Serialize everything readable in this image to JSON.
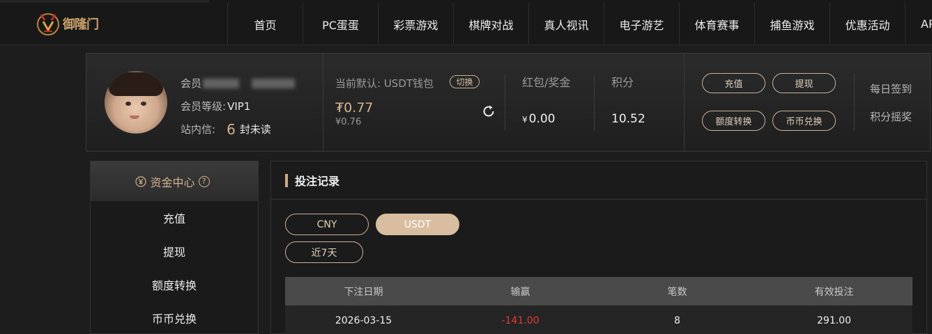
{
  "header": {
    "logo_text": "御隆门",
    "nav": [
      "首页",
      "PC蛋蛋",
      "彩票游戏",
      "棋牌对战",
      "真人视讯",
      "电子游艺",
      "体育赛事",
      "捕鱼游戏",
      "优惠活动",
      "AP"
    ]
  },
  "profile": {
    "member_label": "会员",
    "level_label": "会员等级:",
    "level_value": "VIP1",
    "mail_label": "站内信:",
    "unread_count": "6",
    "unread_text": "封未读",
    "wallet_label": "当前默认: USDT钱包",
    "switch_label": "切换",
    "usdt_balance": "₮0.77",
    "cny_balance": "¥0.76",
    "redpack_label": "红包/奖金",
    "redpack_currency": "¥",
    "redpack_value": "0.00",
    "points_label": "积分",
    "points_value": "10.52",
    "buttons": {
      "deposit": "充值",
      "withdraw": "提现",
      "transfer": "额度转换",
      "exchange": "币币兑换"
    },
    "daily_checkin": "每日签到",
    "points_lottery": "积分摇奖"
  },
  "sidebar": {
    "title": "资金中心",
    "help_glyph": "?",
    "items": [
      "充值",
      "提现",
      "额度转换",
      "币币兑换"
    ]
  },
  "main": {
    "title": "投注记录",
    "currency_tabs": [
      "CNY",
      "USDT"
    ],
    "active_tab": "USDT",
    "range_label": "近7天",
    "table": {
      "headers": [
        "下注日期",
        "输赢",
        "笔数",
        "有效投注"
      ],
      "rows": [
        [
          "2026-03-15",
          "-141.00",
          "8",
          "291.00"
        ]
      ]
    }
  },
  "colors": {
    "accent_gold": "#d5b48f",
    "negative_red": "#e03a3a",
    "active_pill": "#d8bda0"
  }
}
